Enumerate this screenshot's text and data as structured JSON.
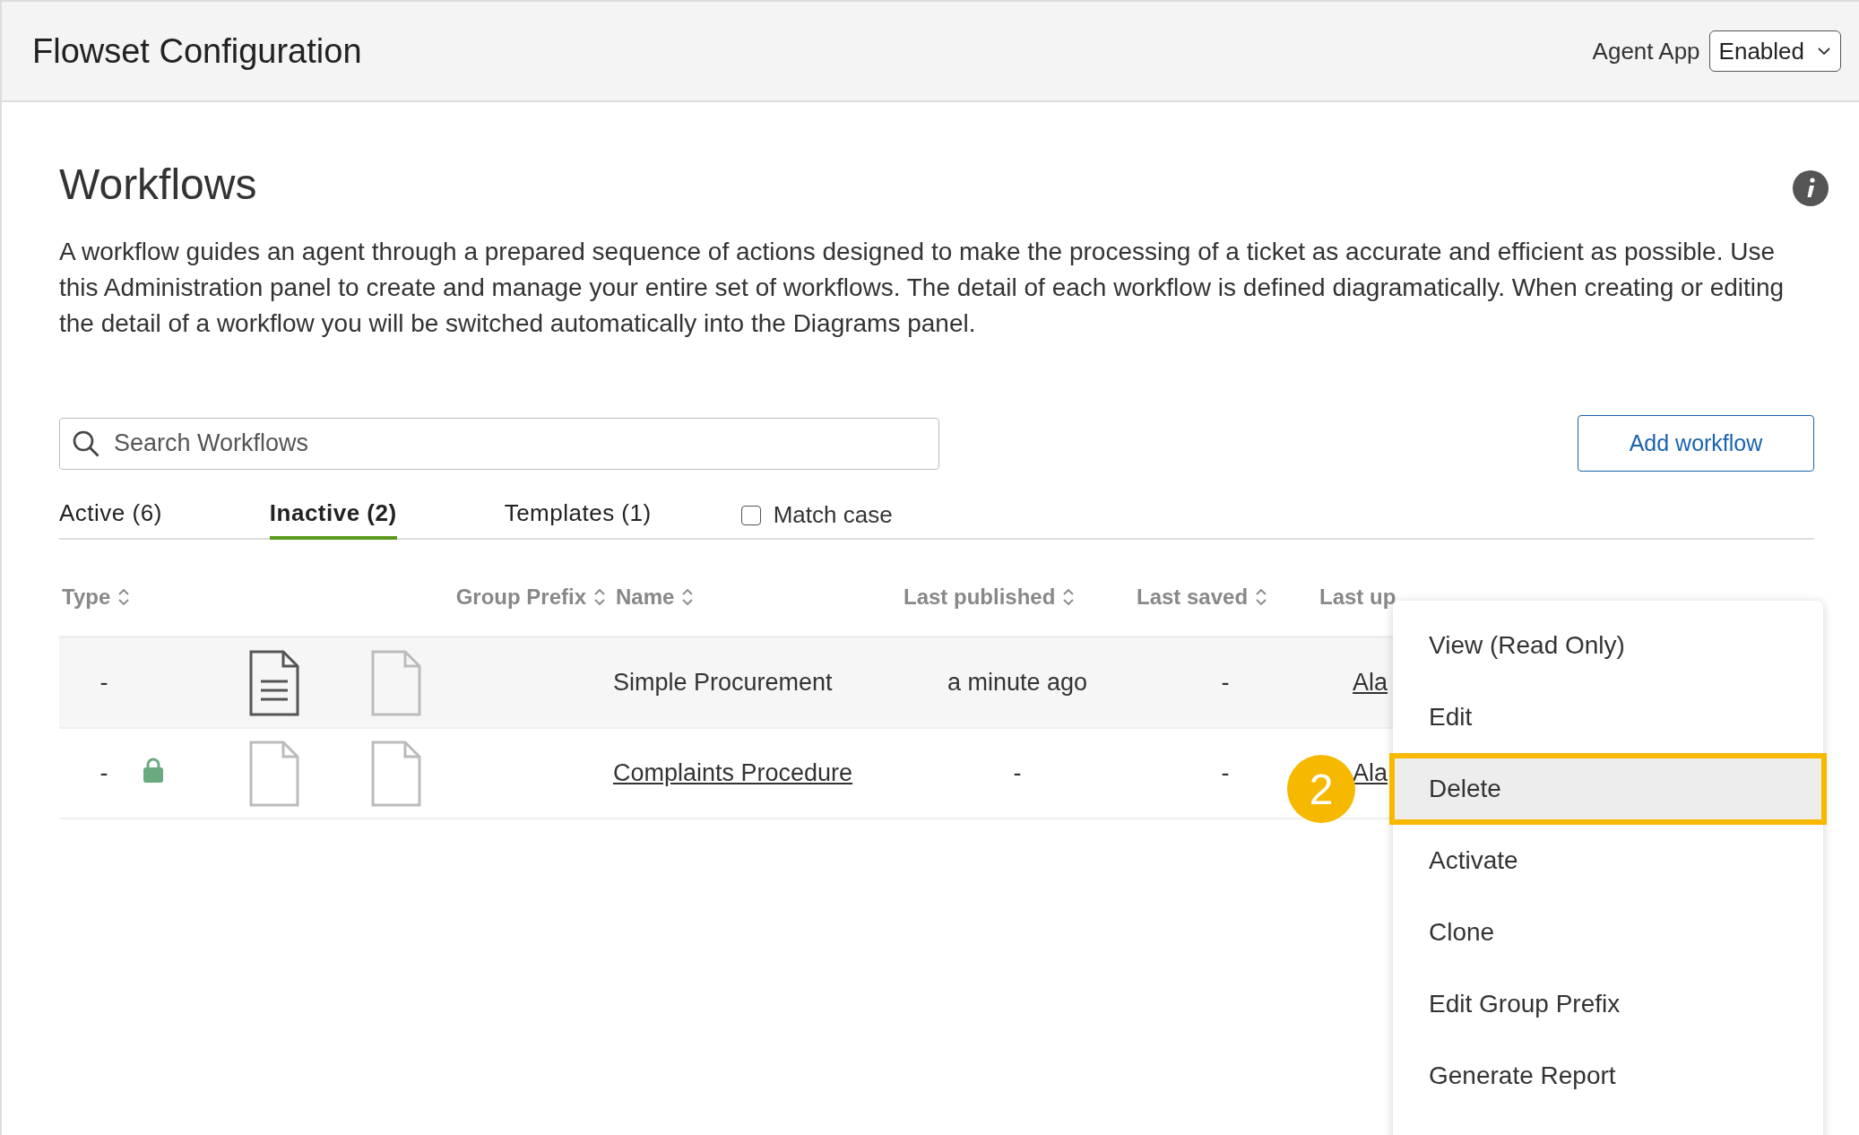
{
  "header": {
    "title": "Flowset Configuration",
    "agent_app_label": "Agent App",
    "agent_app_value": "Enabled"
  },
  "page": {
    "heading": "Workflows",
    "description": "A workflow guides an agent through a prepared sequence of actions designed to make the processing of a ticket as accurate and efficient as possible. Use this Administration panel to create and manage your entire set of workflows. The detail of each workflow is defined diagramatically. When creating or editing the detail of a workflow you will be switched automatically into the Diagrams panel."
  },
  "search": {
    "placeholder": "Search Workflows"
  },
  "add_button": "Add workflow",
  "tabs": [
    {
      "label": "Active (6)",
      "selected": false
    },
    {
      "label": "Inactive (2)",
      "selected": true
    },
    {
      "label": "Templates (1)",
      "selected": false
    }
  ],
  "match_case": {
    "label": "Match case",
    "checked": false
  },
  "table": {
    "columns": [
      "Type",
      "Group Prefix",
      "Name",
      "Last published",
      "Last saved",
      "Last up"
    ],
    "rows": [
      {
        "type": "-",
        "locked": false,
        "has_content": true,
        "name": "Simple Procurement",
        "name_link": false,
        "last_published": "a minute ago",
        "last_saved": "-",
        "last_updated_by": "Ala",
        "highlighted": true
      },
      {
        "type": "-",
        "locked": true,
        "has_content": false,
        "name": "Complaints Procedure",
        "name_link": true,
        "last_published": "-",
        "last_saved": "-",
        "last_updated_by": "Ala",
        "highlighted": false
      }
    ]
  },
  "context_menu": [
    {
      "label": "View (Read Only)",
      "highlighted": false
    },
    {
      "label": "Edit",
      "highlighted": false
    },
    {
      "label": "Delete",
      "highlighted": true,
      "callout": "2"
    },
    {
      "label": "Activate",
      "highlighted": false
    },
    {
      "label": "Clone",
      "highlighted": false
    },
    {
      "label": "Edit Group Prefix",
      "highlighted": false
    },
    {
      "label": "Generate Report",
      "highlighted": false
    }
  ]
}
